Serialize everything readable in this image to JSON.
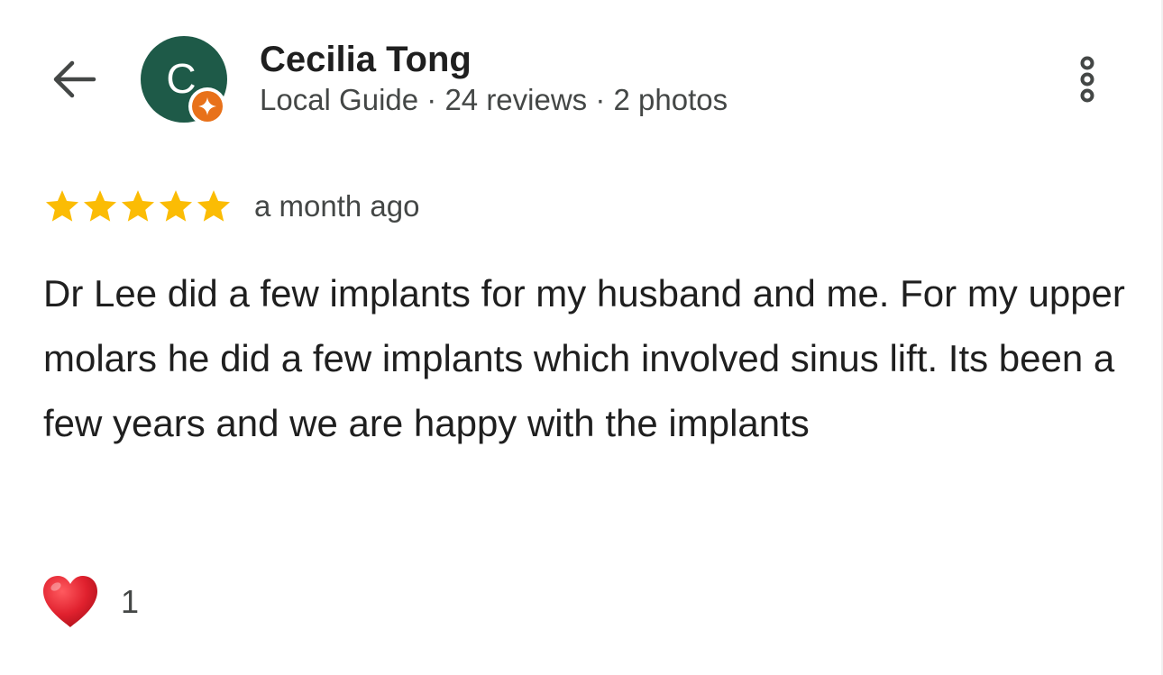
{
  "header": {
    "back_icon": "arrow-left-icon",
    "avatar_letter": "C",
    "badge_icon": "local-guide-star-icon",
    "reviewer_name": "Cecilia Tong",
    "reviewer_meta": "Local Guide · 24 reviews · 2 photos",
    "more_icon": "more-vertical-icon"
  },
  "review": {
    "rating": 5,
    "rating_max": 5,
    "date": "a month ago",
    "text": "Dr Lee did a few implants for my husband and me. For my upper molars he did a few implants which involved sinus lift. Its been a few years and we are happy with the implants"
  },
  "reactions": {
    "icon": "red-heart-icon",
    "count": "1"
  },
  "colors": {
    "avatar_bg": "#1e5a48",
    "badge": "#e8711a",
    "star": "#fbbc04",
    "heart": "#e0212e",
    "text_primary": "#1f1f1f",
    "text_secondary": "#444746"
  }
}
